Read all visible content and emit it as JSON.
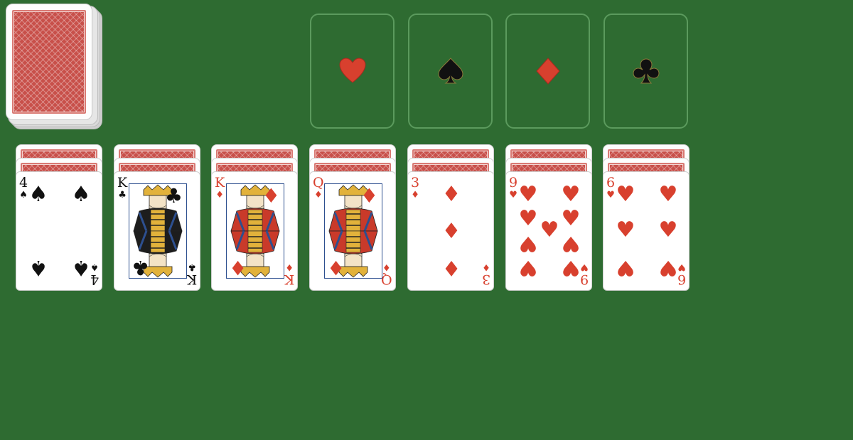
{
  "game": {
    "stock": {
      "label": "Stock"
    },
    "foundations": [
      {
        "suit": "hearts",
        "symbol": "♥",
        "color": "#d8402e",
        "icon": "heart-icon"
      },
      {
        "suit": "spades",
        "symbol": "♠",
        "color": "#111111",
        "icon": "spade-icon"
      },
      {
        "suit": "diamonds",
        "symbol": "♦",
        "color": "#d8402e",
        "icon": "diamond-icon"
      },
      {
        "suit": "clubs",
        "symbol": "♣",
        "color": "#111111",
        "icon": "club-icon"
      }
    ],
    "tableau": [
      {
        "facedown": 2,
        "card": {
          "rank": "4",
          "suit": "♠",
          "color": "black",
          "kind": "pip"
        }
      },
      {
        "facedown": 2,
        "card": {
          "rank": "K",
          "suit": "♣",
          "color": "black",
          "kind": "court"
        }
      },
      {
        "facedown": 2,
        "card": {
          "rank": "K",
          "suit": "♦",
          "color": "red",
          "kind": "court"
        }
      },
      {
        "facedown": 2,
        "card": {
          "rank": "Q",
          "suit": "♦",
          "color": "red",
          "kind": "court"
        }
      },
      {
        "facedown": 2,
        "card": {
          "rank": "3",
          "suit": "♦",
          "color": "red",
          "kind": "pip"
        }
      },
      {
        "facedown": 2,
        "card": {
          "rank": "9",
          "suit": "♥",
          "color": "red",
          "kind": "pip"
        }
      },
      {
        "facedown": 2,
        "card": {
          "rank": "6",
          "suit": "♥",
          "color": "red",
          "kind": "pip"
        }
      }
    ]
  }
}
